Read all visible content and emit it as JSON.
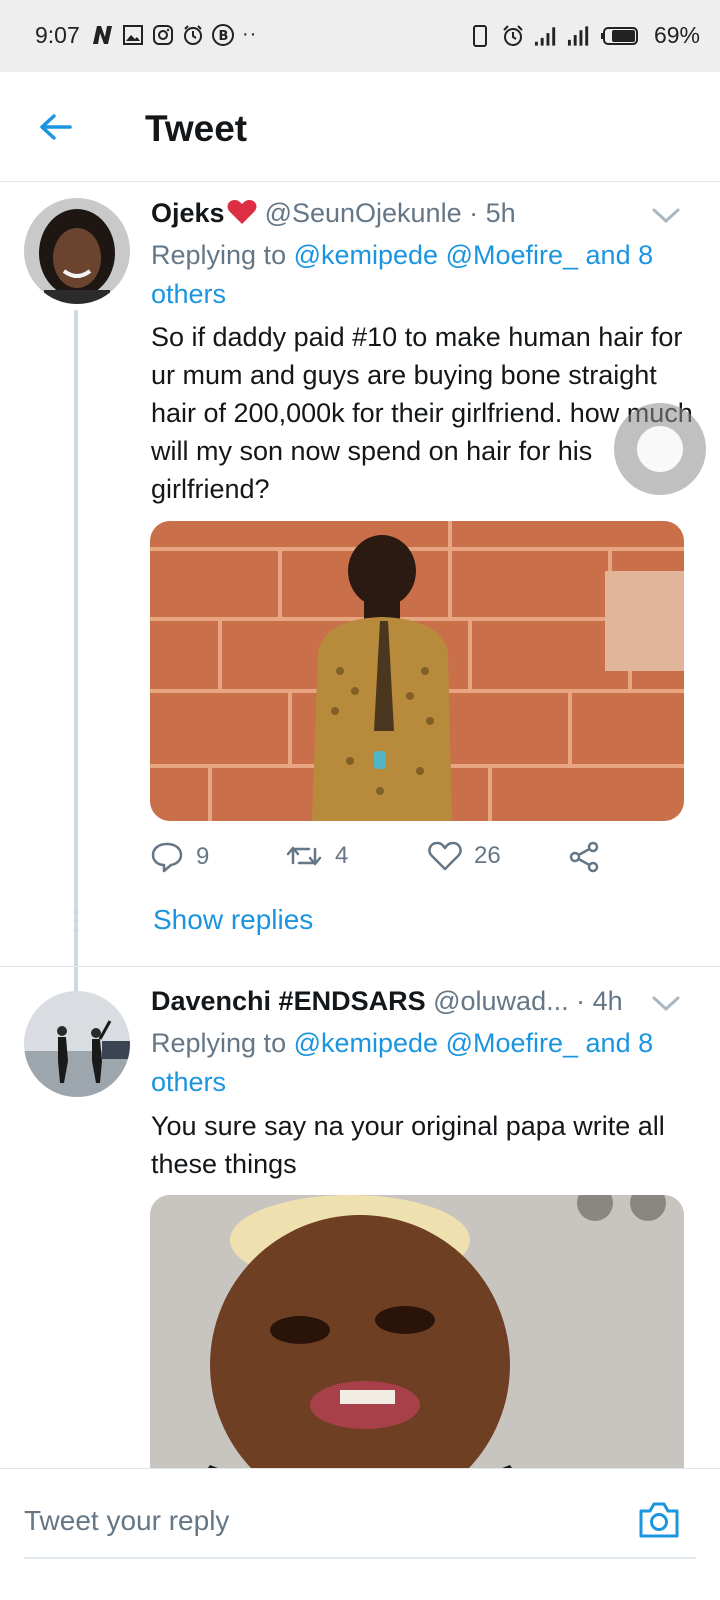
{
  "status_bar": {
    "time": "9:07",
    "battery": "69%",
    "left_icons": [
      "nairaland-icon",
      "image-icon",
      "instagram-icon",
      "alarm-icon",
      "b-icon",
      "more-dots-icon"
    ],
    "right_icons": [
      "vibrate-icon",
      "alarm-icon",
      "signal-icon",
      "signal-icon",
      "battery-icon"
    ]
  },
  "header": {
    "title": "Tweet",
    "back_icon": "back-arrow-icon"
  },
  "tweets": [
    {
      "name": "Ojeks",
      "name_emoji": "heart",
      "handle": "@SeunOjekunle",
      "dot": "·",
      "time": "5h",
      "replying_prefix": "Replying to ",
      "mentions": "@kemipede @Moefire_ and 8 others",
      "text": "So if daddy  paid #10 to make human hair for ur mum and guys are buying bone straight hair  of 200,000k for their girlfriend. how much will my son now spend on hair for his girlfriend?",
      "actions": {
        "replies": "9",
        "retweets": "4",
        "likes": "26"
      },
      "show_replies": "Show replies"
    },
    {
      "name": "Davenchi #ENDSARS",
      "handle": "@oluwad...",
      "dot": "·",
      "time": "4h",
      "replying_prefix": "Replying to ",
      "mentions": "@kemipede @Moefire_ and 8 others",
      "text": "You sure say na your original papa write all these things"
    }
  ],
  "reply_bar": {
    "placeholder": "Tweet your reply"
  },
  "colors": {
    "accent": "#1b95e0",
    "muted": "#657786",
    "text": "#14171a"
  }
}
